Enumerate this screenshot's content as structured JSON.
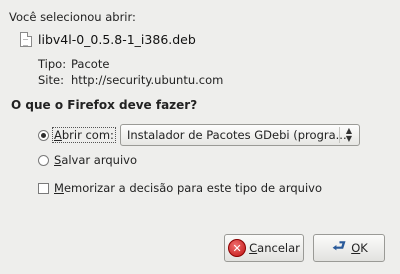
{
  "dialog": {
    "intro": "Você selecionou abrir:",
    "filename": "libv4l-0_0.5.8-1_i386.deb",
    "type_label": "Tipo:",
    "type_value": "Pacote",
    "site_label": "Site:",
    "site_value": "http://security.ubuntu.com",
    "question": "O que o Firefox deve fazer?"
  },
  "options": {
    "open_with": {
      "mnemonic": "A",
      "rest": "brir com:",
      "checked": true
    },
    "open_with_app": "Instalador de Pacotes GDebi (progra...",
    "save": {
      "mnemonic": "S",
      "rest": "alvar arquivo",
      "checked": false
    },
    "remember": {
      "mnemonic": "M",
      "rest": "emorizar a decisão para este tipo de arquivo",
      "checked": false
    }
  },
  "buttons": {
    "cancel": {
      "mnemonic": "C",
      "rest": "ancelar"
    },
    "ok": {
      "mnemonic": "O",
      "rest": "K"
    }
  },
  "icons": {
    "file": "file-icon",
    "combo": "updown-arrows-icon",
    "cancel": "cancel-icon",
    "ok": "ok-arrow-icon"
  },
  "colors": {
    "background": "#eeeeec",
    "cancel_red": "#c01010",
    "ok_blue": "#2a5a9a"
  }
}
